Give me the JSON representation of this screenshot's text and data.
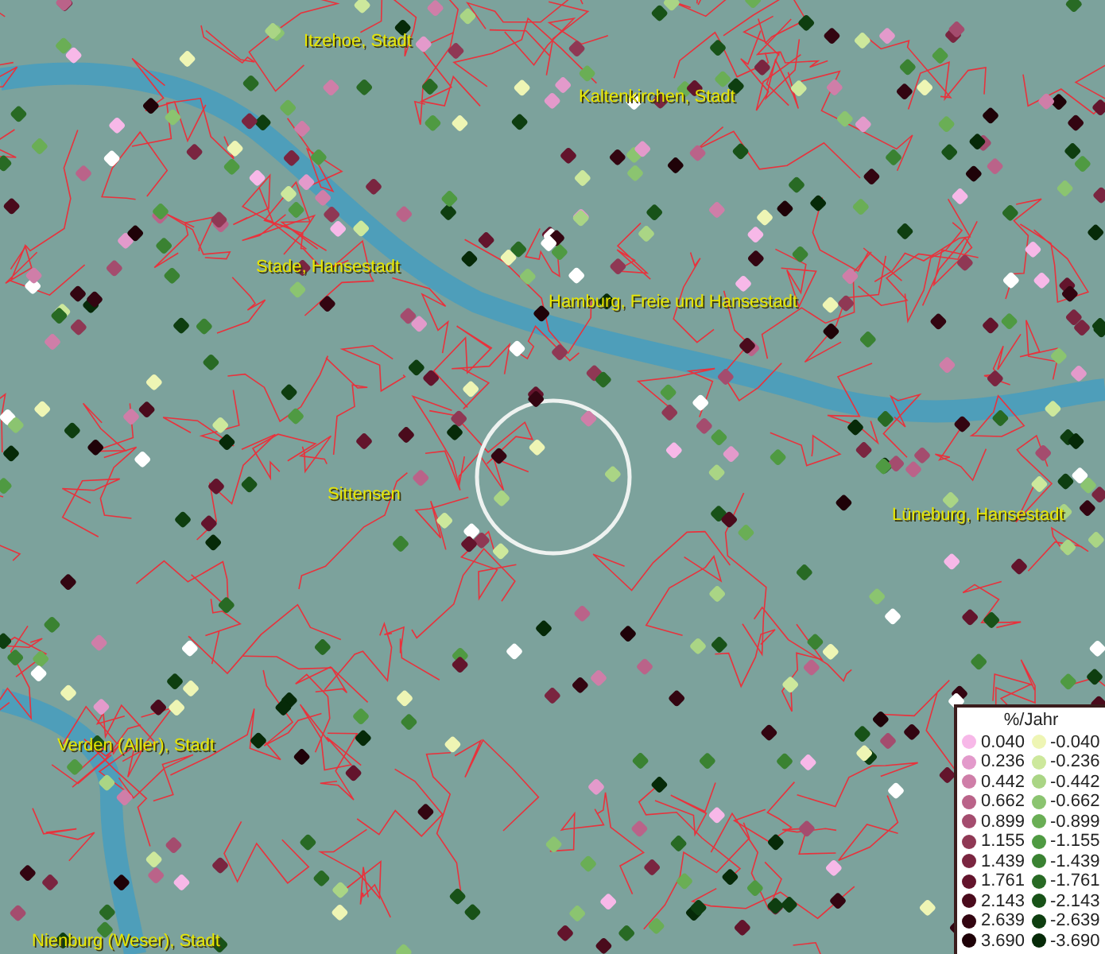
{
  "map": {
    "place_labels": [
      "Itzehoe, Stadt",
      "Kaltenkirchen, Stadt",
      "Stade, Hansestadt",
      "Hamburg, Freie und Hansestadt",
      "Sittensen",
      "Lüneburg, Hansestadt",
      "Verden (Aller), Stadt",
      "Nienburg (Weser), Stadt"
    ]
  },
  "legend": {
    "title": "%/Jahr",
    "rows": [
      {
        "positive": {
          "value": "0.040",
          "color": "#f7b8e8"
        },
        "negative": {
          "value": "-0.040",
          "color": "#eef5b4"
        }
      },
      {
        "positive": {
          "value": "0.236",
          "color": "#e39acb"
        },
        "negative": {
          "value": "-0.236",
          "color": "#cde89c"
        }
      },
      {
        "positive": {
          "value": "0.442",
          "color": "#cf7ea8"
        },
        "negative": {
          "value": "-0.442",
          "color": "#aad585"
        }
      },
      {
        "positive": {
          "value": "0.662",
          "color": "#ba6389"
        },
        "negative": {
          "value": "-0.662",
          "color": "#8bc470"
        }
      },
      {
        "positive": {
          "value": "0.899",
          "color": "#a44c6e"
        },
        "negative": {
          "value": "-0.899",
          "color": "#6aae55"
        }
      },
      {
        "positive": {
          "value": "1.155",
          "color": "#8f3854"
        },
        "negative": {
          "value": "-1.155",
          "color": "#4f9a42"
        }
      },
      {
        "positive": {
          "value": "1.439",
          "color": "#7a2540"
        },
        "negative": {
          "value": "-1.439",
          "color": "#3a8232"
        }
      },
      {
        "positive": {
          "value": "1.761",
          "color": "#63142c"
        },
        "negative": {
          "value": "-1.761",
          "color": "#286a24"
        }
      },
      {
        "positive": {
          "value": "2.143",
          "color": "#4a0b1c"
        },
        "negative": {
          "value": "-2.143",
          "color": "#185218"
        }
      },
      {
        "positive": {
          "value": "2.639",
          "color": "#330511"
        },
        "negative": {
          "value": "-2.639",
          "color": "#0e3e10"
        }
      },
      {
        "positive": {
          "value": "3.690",
          "color": "#1f0208"
        },
        "negative": {
          "value": "-3.690",
          "color": "#062a08"
        }
      }
    ]
  }
}
